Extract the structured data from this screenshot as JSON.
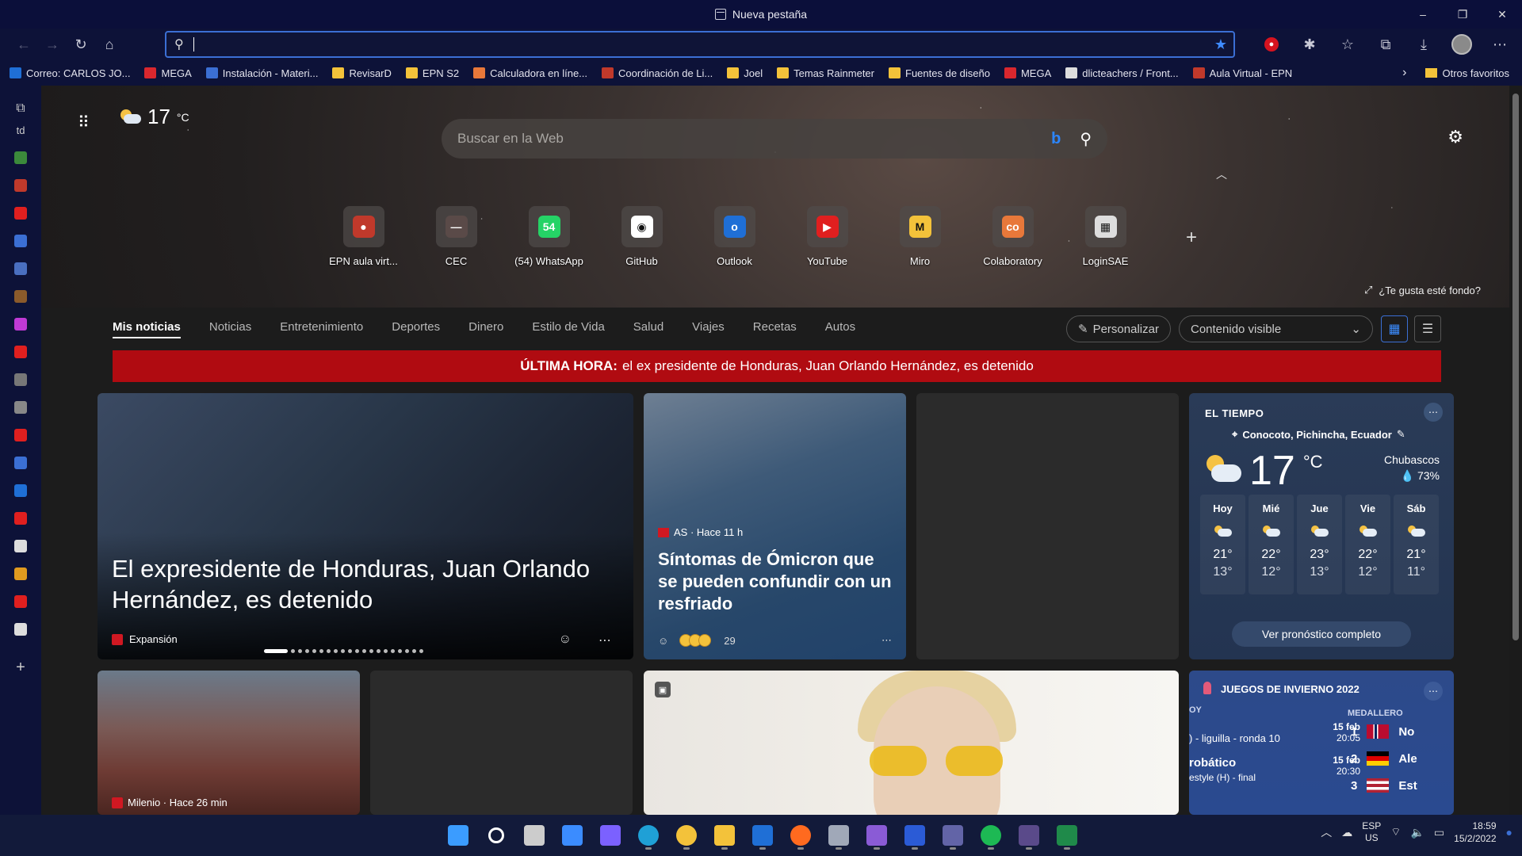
{
  "window": {
    "title": "Nueva pestaña",
    "controls": [
      "–",
      "❐",
      "✕"
    ]
  },
  "toolbar": {
    "address_value": ""
  },
  "favorites": [
    {
      "label": "Correo: CARLOS JO...",
      "color": "#1f6fd6"
    },
    {
      "label": "MEGA",
      "color": "#d9272e"
    },
    {
      "label": "Instalación - Materi...",
      "color": "#3b6fd4"
    },
    {
      "label": "RevisarD",
      "color": "#f3c23a"
    },
    {
      "label": "EPN S2",
      "color": "#f3c23a"
    },
    {
      "label": "Calculadora en líne...",
      "color": "#e8783a"
    },
    {
      "label": "Coordinación de Li...",
      "color": "#c0392b"
    },
    {
      "label": "Joel",
      "color": "#f3c23a"
    },
    {
      "label": "Temas Rainmeter",
      "color": "#f3c23a"
    },
    {
      "label": "Fuentes de diseño",
      "color": "#f3c23a"
    },
    {
      "label": "MEGA",
      "color": "#d9272e"
    },
    {
      "label": "dlicteachers / Front...",
      "color": "#dddddd"
    },
    {
      "label": "Aula Virtual - EPN",
      "color": "#c0392b"
    }
  ],
  "favorites_more": "Otros favoritos",
  "sidebar": {
    "tab_text": "td",
    "icons": [
      "#3b8a3b",
      "#c0392b",
      "#e01f1f",
      "#3b6fd4",
      "#4a6fc0",
      "#8b5a2b",
      "#c03ad6",
      "#e01f1f",
      "#777777",
      "#888888",
      "#e01f1f",
      "#3b6fd4",
      "#1f6fd6",
      "#e01f1f",
      "#dddddd",
      "#e09a1f",
      "#e01f1f",
      "#dddddd"
    ]
  },
  "newtab": {
    "weather_temp": "17",
    "weather_unit": "°C",
    "search_placeholder": "Buscar en la Web",
    "quicklinks": [
      {
        "label": "EPN aula virt...",
        "color": "#c0392b",
        "glyph": "●"
      },
      {
        "label": "CEC",
        "color": "#5a4a48",
        "glyph": "—"
      },
      {
        "label": "(54) WhatsApp",
        "color": "#25d366",
        "glyph": "54"
      },
      {
        "label": "GitHub",
        "color": "#ffffff",
        "glyph": "◉"
      },
      {
        "label": "Outlook",
        "color": "#1f6fd6",
        "glyph": "o"
      },
      {
        "label": "YouTube",
        "color": "#e01f1f",
        "glyph": "▶"
      },
      {
        "label": "Miro",
        "color": "#f3c23a",
        "glyph": "M"
      },
      {
        "label": "Colaboratory",
        "color": "#e8783a",
        "glyph": "co"
      },
      {
        "label": "LoginSAE",
        "color": "#dddddd",
        "glyph": "▦"
      }
    ],
    "add_label": "+",
    "like_bg": "¿Te gusta esté fondo?"
  },
  "news": {
    "tabs": [
      "Mis noticias",
      "Noticias",
      "Entretenimiento",
      "Deportes",
      "Dinero",
      "Estilo de Vida",
      "Salud",
      "Viajes",
      "Recetas",
      "Autos"
    ],
    "personalize": "Personalizar",
    "visible_content": "Contenido visible",
    "breaking_label": "ÚLTIMA HORA:",
    "breaking_text": "el ex presidente de Honduras, Juan Orlando Hernández, es detenido",
    "hero": {
      "headline": "El expresidente de Honduras, Juan Orlando Hernández, es detenido",
      "source": "Expansión"
    },
    "card2": {
      "source": "AS · Hace 11 h",
      "headline": "Síntomas de Ómicron que se pueden confundir con un resfriado",
      "reactions": "29"
    },
    "card5": {
      "source": "Milenio · Hace 26 min"
    }
  },
  "weather_card": {
    "title": "EL TIEMPO",
    "location": "Conocoto, Pichincha, Ecuador",
    "temp": "17",
    "unit": "°C",
    "condition": "Chubascos",
    "humidity": "73%",
    "days": [
      {
        "name": "Hoy",
        "hi": "21°",
        "lo": "13°"
      },
      {
        "name": "Mié",
        "hi": "22°",
        "lo": "12°"
      },
      {
        "name": "Jue",
        "hi": "23°",
        "lo": "13°"
      },
      {
        "name": "Vie",
        "hi": "22°",
        "lo": "12°"
      },
      {
        "name": "Sáb",
        "hi": "21°",
        "lo": "11°"
      }
    ],
    "forecast_btn": "Ver pronóstico completo"
  },
  "olympics": {
    "title": "JUEGOS DE INVIERNO 2022",
    "today": "OY",
    "medal_header": "MEDALLERO",
    "events": [
      {
        "name": ") - liguilla - ronda 10",
        "date": "15 feb",
        "time": "20:05"
      },
      {
        "name": "robático",
        "sub": "estyle (H) - final",
        "date": "15 feb",
        "time": "20:30"
      }
    ],
    "medals": [
      {
        "rank": "1",
        "country": "No"
      },
      {
        "rank": "2",
        "country": "Ale"
      },
      {
        "rank": "3",
        "country": "Est"
      }
    ]
  },
  "taskbar": {
    "apps": [
      {
        "name": "start",
        "color": "#3b9cff"
      },
      {
        "name": "search",
        "color": "#ffffff"
      },
      {
        "name": "task-view",
        "color": "#cccccc"
      },
      {
        "name": "widgets",
        "color": "#3b8cff"
      },
      {
        "name": "chat",
        "color": "#7b61ff"
      },
      {
        "name": "edge",
        "color": "#1fa0d6"
      },
      {
        "name": "chrome",
        "color": "#f3c23a"
      },
      {
        "name": "explorer",
        "color": "#f3c23a"
      },
      {
        "name": "mail",
        "color": "#1f6fd6"
      },
      {
        "name": "firefox",
        "color": "#ff6a1f"
      },
      {
        "name": "settings",
        "color": "#a0a8b8"
      },
      {
        "name": "visual-studio",
        "color": "#8a5bd6"
      },
      {
        "name": "word",
        "color": "#2b5bd6"
      },
      {
        "name": "teams",
        "color": "#6264a7"
      },
      {
        "name": "spotify",
        "color": "#1db954"
      },
      {
        "name": "terminal",
        "color": "#5a4a8a"
      },
      {
        "name": "excel",
        "color": "#1f8a4a"
      }
    ],
    "lang_top": "ESP",
    "lang_bottom": "US",
    "time": "18:59",
    "date": "15/2/2022"
  }
}
